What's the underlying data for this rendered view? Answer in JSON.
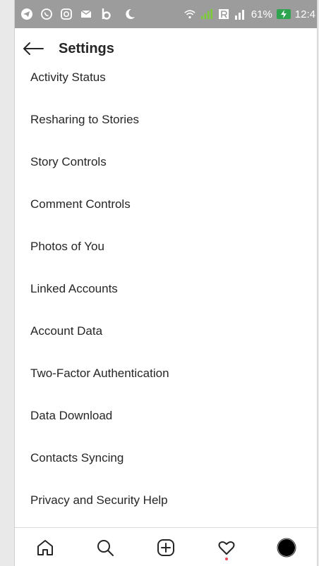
{
  "status_bar": {
    "battery_percent": "61%",
    "time": "12:4",
    "icons": [
      "telegram-icon",
      "whatsapp-icon",
      "instagram-icon",
      "mail-icon",
      "b-app-icon",
      "phone-icon",
      "wifi-icon",
      "signal-icon",
      "r-badge-icon",
      "signal-2-icon",
      "battery-charging-icon"
    ],
    "background_color": "#9c9c9c",
    "battery_color": "#2ea44f"
  },
  "header": {
    "title": "Settings",
    "back_icon": "arrow-left-icon"
  },
  "settings_items": [
    {
      "label": "Activity Status"
    },
    {
      "label": "Resharing to Stories"
    },
    {
      "label": "Story Controls"
    },
    {
      "label": "Comment Controls"
    },
    {
      "label": "Photos of You"
    },
    {
      "label": "Linked Accounts"
    },
    {
      "label": "Account Data"
    },
    {
      "label": "Two-Factor Authentication"
    },
    {
      "label": "Data Download"
    },
    {
      "label": "Contacts Syncing"
    },
    {
      "label": "Privacy and Security Help"
    }
  ],
  "bottom_nav": [
    {
      "icon": "home-icon"
    },
    {
      "icon": "search-icon"
    },
    {
      "icon": "add-post-icon"
    },
    {
      "icon": "activity-heart-icon",
      "notification_dot": true
    },
    {
      "icon": "profile-avatar-icon"
    }
  ],
  "colors": {
    "text": "#262626",
    "notification_dot": "#ed4956"
  }
}
